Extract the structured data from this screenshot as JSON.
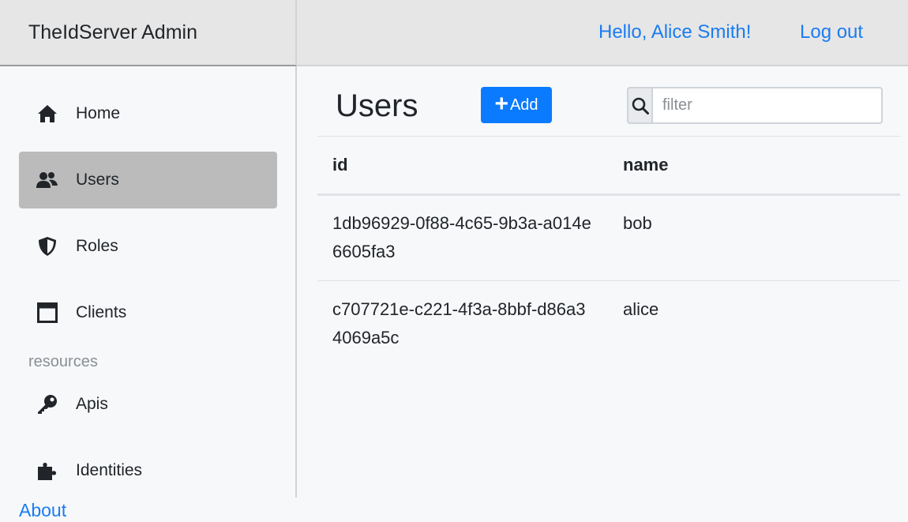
{
  "app": {
    "title": "TheIdServer Admin"
  },
  "header": {
    "greeting": "Hello, Alice Smith!",
    "logout_label": "Log out"
  },
  "sidebar": {
    "items": [
      {
        "label": "Home",
        "icon": "home-icon"
      },
      {
        "label": "Users",
        "icon": "users-icon",
        "active": true
      },
      {
        "label": "Roles",
        "icon": "shield-icon"
      },
      {
        "label": "Clients",
        "icon": "window-icon"
      }
    ],
    "section_label": "resources",
    "resource_items": [
      {
        "label": "Apis",
        "icon": "key-icon"
      },
      {
        "label": "Identities",
        "icon": "puzzle-icon"
      }
    ],
    "about_label": "About"
  },
  "main": {
    "title": "Users",
    "add_label": "Add",
    "search": {
      "placeholder": "filter",
      "value": ""
    },
    "table": {
      "columns": [
        "id",
        "name"
      ],
      "rows": [
        {
          "id": "1db96929-0f88-4c65-9b3a-a014e6605fa3",
          "name": "bob"
        },
        {
          "id": "c707721e-c221-4f3a-8bbf-d86a34069a5c",
          "name": "alice"
        }
      ]
    }
  },
  "colors": {
    "accent": "#0a7bff",
    "link": "#1a7cf0",
    "active_nav": "#babbba",
    "header_bg": "#e6e6e6"
  }
}
